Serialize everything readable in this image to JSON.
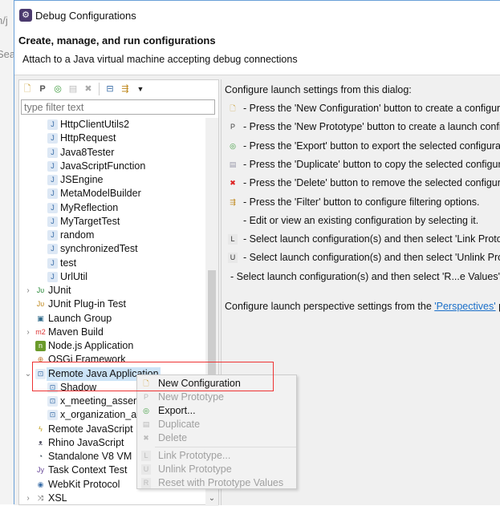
{
  "background": {
    "fragments": [
      "n/j",
      "Sea"
    ]
  },
  "window": {
    "title": "Debug Configurations"
  },
  "header": {
    "title": "Create, manage, and run configurations",
    "message": "Attach to a Java virtual machine accepting debug connections"
  },
  "toolbar": {
    "buttons": [
      {
        "name": "new-configuration",
        "icon": "new-config-icon"
      },
      {
        "name": "new-prototype",
        "icon": "new-prototype-icon"
      },
      {
        "name": "export",
        "icon": "export-icon"
      },
      {
        "name": "duplicate",
        "icon": "duplicate-icon"
      },
      {
        "name": "delete",
        "icon": "delete-icon"
      },
      {
        "name": "collapse-all",
        "icon": "collapse-icon"
      },
      {
        "name": "filter",
        "icon": "filter-icon"
      },
      {
        "name": "view-menu",
        "icon": "dropdown-icon"
      }
    ]
  },
  "filter": {
    "placeholder": "type filter text"
  },
  "tree": [
    {
      "label": "HttpClientUtils2",
      "level": 1,
      "icon": "java-app-icon"
    },
    {
      "label": "HttpRequest",
      "level": 1,
      "icon": "java-app-icon"
    },
    {
      "label": "Java8Tester",
      "level": 1,
      "icon": "java-app-icon"
    },
    {
      "label": "JavaScriptFunction",
      "level": 1,
      "icon": "java-app-icon"
    },
    {
      "label": "JSEngine",
      "level": 1,
      "icon": "java-app-icon"
    },
    {
      "label": "MetaModelBuilder",
      "level": 1,
      "icon": "java-app-icon"
    },
    {
      "label": "MyReflection",
      "level": 1,
      "icon": "java-app-icon"
    },
    {
      "label": "MyTargetTest",
      "level": 1,
      "icon": "java-app-icon"
    },
    {
      "label": "random",
      "level": 1,
      "icon": "java-app-icon"
    },
    {
      "label": "synchronizedTest",
      "level": 1,
      "icon": "java-app-icon"
    },
    {
      "label": "test",
      "level": 1,
      "icon": "java-app-icon"
    },
    {
      "label": "UrlUtil",
      "level": 1,
      "icon": "java-app-icon"
    },
    {
      "label": "JUnit",
      "level": 0,
      "icon": "junit-icon",
      "expander": "collapsed"
    },
    {
      "label": "JUnit Plug-in Test",
      "level": 0,
      "icon": "junit-plugin-icon"
    },
    {
      "label": "Launch Group",
      "level": 0,
      "icon": "launch-group-icon"
    },
    {
      "label": "Maven Build",
      "level": 0,
      "icon": "maven-icon",
      "expander": "collapsed"
    },
    {
      "label": "Node.js Application",
      "level": 0,
      "icon": "nodejs-icon"
    },
    {
      "label": "OSGi Framework",
      "level": 0,
      "icon": "osgi-icon"
    },
    {
      "label": "Remote Java Application",
      "level": 0,
      "icon": "remote-java-icon",
      "expander": "expanded",
      "selected": true
    },
    {
      "label": "Shadow",
      "level": 1,
      "icon": "remote-java-icon"
    },
    {
      "label": "x_meeting_assem",
      "level": 1,
      "icon": "remote-java-icon"
    },
    {
      "label": "x_organization_as",
      "level": 1,
      "icon": "remote-java-icon"
    },
    {
      "label": "Remote JavaScript",
      "level": 0,
      "icon": "remote-js-icon"
    },
    {
      "label": "Rhino JavaScript",
      "level": 0,
      "icon": "rhino-icon"
    },
    {
      "label": "Standalone V8 VM",
      "level": 0,
      "icon": "v8-icon"
    },
    {
      "label": "Task Context Test",
      "level": 0,
      "icon": "task-context-icon"
    },
    {
      "label": "WebKit Protocol",
      "level": 0,
      "icon": "webkit-icon"
    },
    {
      "label": "XSL",
      "level": 0,
      "icon": "xsl-icon",
      "expander": "collapsed"
    }
  ],
  "right": {
    "intro": "Configure launch settings from this dialog:",
    "lines": [
      {
        "icon": "new-config-icon",
        "text": "- Press the 'New Configuration' button to create a configura"
      },
      {
        "icon": "new-prototype-icon",
        "text": "- Press the 'New Prototype' button to create a launch config"
      },
      {
        "icon": "export-icon",
        "text": "- Press the 'Export' button to export the selected configurat"
      },
      {
        "icon": "duplicate-icon",
        "text": "- Press the 'Duplicate' button to copy the selected configura"
      },
      {
        "icon": "delete-icon",
        "text": "- Press the 'Delete' button to remove the selected configura"
      },
      {
        "icon": "filter-icon",
        "text": "- Press the 'Filter' button to configure filtering options."
      },
      {
        "icon": "",
        "text": "- Edit or view an existing configuration by selecting it."
      },
      {
        "icon": "link-prototype-icon",
        "text": "- Select launch configuration(s) and then select 'Link Prototy"
      },
      {
        "icon": "unlink-prototype-icon",
        "text": "- Select launch configuration(s) and then select 'Unlink Proto"
      },
      {
        "icon": "",
        "text": "- Select launch configuration(s) and then select 'R...e Values' me"
      }
    ],
    "perspectives_prefix": "Configure launch perspective settings from the ",
    "perspectives_link": "'Perspectives'",
    "perspectives_suffix": " p"
  },
  "context_menu": {
    "items": [
      {
        "label": "New Configuration",
        "icon": "new-config-icon",
        "enabled": true
      },
      {
        "label": "New Prototype",
        "icon": "new-prototype-icon",
        "enabled": false
      },
      {
        "label": "Export...",
        "icon": "export-icon",
        "enabled": true
      },
      {
        "label": "Duplicate",
        "icon": "duplicate-icon",
        "enabled": false
      },
      {
        "label": "Delete",
        "icon": "delete-icon",
        "enabled": false
      },
      {
        "label": "Link Prototype...",
        "icon": "link-prototype-icon",
        "enabled": false
      },
      {
        "label": "Unlink Prototype",
        "icon": "unlink-prototype-icon",
        "enabled": false
      },
      {
        "label": "Reset with Prototype Values",
        "icon": "reset-prototype-icon",
        "enabled": false
      }
    ]
  },
  "colors": {
    "selection": "#cce4f7",
    "highlight_box": "#e33333",
    "link": "#1a6fc9"
  }
}
